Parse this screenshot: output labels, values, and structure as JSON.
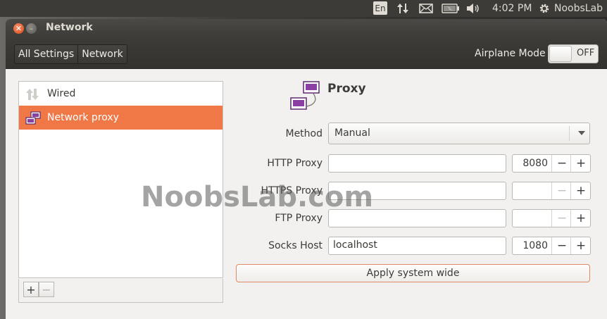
{
  "top_panel": {
    "lang": "En",
    "clock": "4:02 PM",
    "user": "NoobsLab"
  },
  "window": {
    "title": "Network"
  },
  "toolbar": {
    "crumb_all": "All Settings",
    "crumb_network": "Network",
    "airplane_label": "Airplane Mode",
    "airplane_state": "OFF"
  },
  "device_list": [
    {
      "label": "Wired",
      "icon": "wired-icon",
      "selected": false
    },
    {
      "label": "Network proxy",
      "icon": "proxy-icon",
      "selected": true
    }
  ],
  "list_buttons": {
    "add": "+",
    "remove": "−"
  },
  "proxy": {
    "title": "Proxy",
    "method_label": "Method",
    "method_value": "Manual",
    "http_label": "HTTP Proxy",
    "http_host": "",
    "http_port": "8080",
    "https_label": "HTTPS Proxy",
    "https_host": "",
    "https_port": "",
    "ftp_label": "FTP Proxy",
    "ftp_host": "",
    "ftp_port": "",
    "socks_label": "Socks Host",
    "socks_host": "localhost",
    "socks_port": "1080",
    "minus": "−",
    "plus": "+",
    "apply": "Apply system wide"
  },
  "watermark": "NoobsLab.com",
  "colors": {
    "accent": "#f07746",
    "panel": "#3c3b37",
    "window_bg": "#f2f1f0"
  }
}
